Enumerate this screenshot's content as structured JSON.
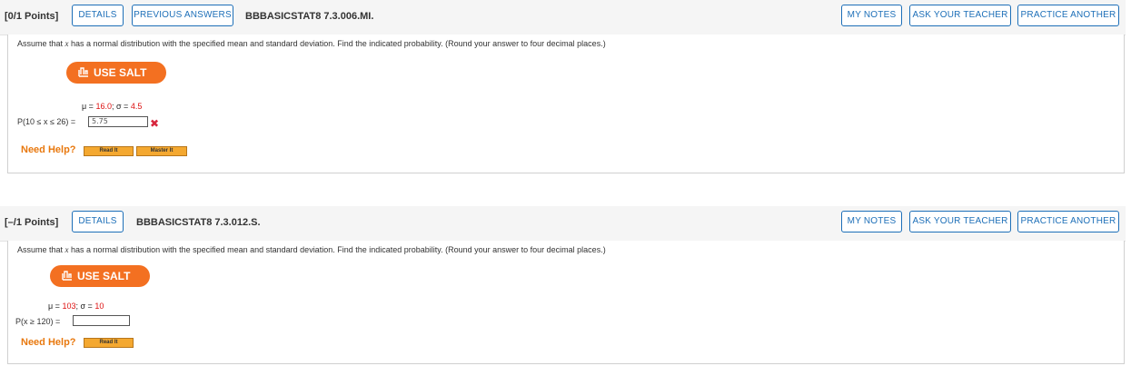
{
  "questions": [
    {
      "points": "[0/1 Points]",
      "details_label": "DETAILS",
      "previous_answers_label": "PREVIOUS ANSWERS",
      "question_id": "BBBASICSTAT8 7.3.006.MI.",
      "my_notes_label": "MY NOTES",
      "ask_teacher_label": "ASK YOUR TEACHER",
      "practice_another_label": "PRACTICE ANOTHER",
      "prompt_pre": "Assume that ",
      "prompt_var": "x",
      "prompt_post": " has a normal distribution with the specified mean and standard deviation. Find the indicated probability. (Round your answer to four decimal places.)",
      "use_salt_label": "USE SALT",
      "mu_label": "μ = ",
      "mu_value": "16.0",
      "sep": "; ",
      "sigma_label": "σ = ",
      "sigma_value": "4.5",
      "prob_label": "P(10 ≤ x ≤ 26) =",
      "answer_value": "5.75",
      "answer_status": "incorrect",
      "need_help_label": "Need Help?",
      "read_it_label": "Read It",
      "master_it_label": "Master It"
    },
    {
      "points": "[–/1 Points]",
      "details_label": "DETAILS",
      "question_id": "BBBASICSTAT8 7.3.012.S.",
      "my_notes_label": "MY NOTES",
      "ask_teacher_label": "ASK YOUR TEACHER",
      "practice_another_label": "PRACTICE ANOTHER",
      "prompt_pre": "Assume that ",
      "prompt_var": "x",
      "prompt_post": " has a normal distribution with the specified mean and standard deviation. Find the indicated probability. (Round your answer to four decimal places.)",
      "use_salt_label": "USE SALT",
      "mu_label": "μ = ",
      "mu_value": "103",
      "sep": "; ",
      "sigma_label": "σ = ",
      "sigma_value": "10",
      "prob_label": "P(x ≥ 120) =",
      "answer_value": "",
      "need_help_label": "Need Help?",
      "read_it_label": "Read It"
    }
  ],
  "colors": {
    "accent_blue": "#1d6fb8",
    "salt_orange": "#f37021",
    "help_orange": "#e8780e",
    "value_red": "#dd1111",
    "error_red": "#d7263d",
    "help_button": "#f4a830"
  },
  "icons": {
    "salt": "salt-calculator-icon",
    "incorrect": "x-mark-icon"
  }
}
